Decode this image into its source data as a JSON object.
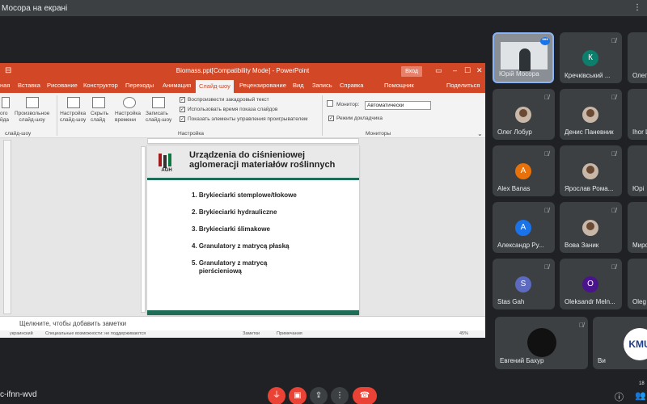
{
  "meet": {
    "top_title": "Мосора на екрані",
    "meeting_code": "c-ifnn-wvd",
    "participant_count": "18"
  },
  "powerpoint": {
    "window_title": "Biomass.ppt[Compatibility Mode]  -  PowerPoint",
    "login_label": "Вход",
    "tabs": [
      "ная",
      "Вставка",
      "Рисование",
      "Конструктор",
      "Переходы",
      "Анимация",
      "Слайд-шоу",
      "Рецензирование",
      "Вид",
      "Запись",
      "Справка",
      "Помощник",
      "Поделиться"
    ],
    "ribbon": {
      "btn_from_start": "ого\nйда",
      "btn_custom": "Произвольное\nслайд-шоу",
      "btn_setup": "Настройка\nслайд-шоу",
      "btn_hide": "Скрыть\nслайд",
      "btn_timing": "Настройка\nвремени",
      "btn_record": "Записать\nслайд-шоу",
      "chk_narration": "Воспроизвести закадровый текст",
      "chk_timings": "Использовать время показа слайдов",
      "chk_controls": "Показать элементы управления проигрывателем",
      "monitor_label": "Монитор:",
      "monitor_value": "Автоматически",
      "presenter_view": "Режим докладчика",
      "group_start": "слайд-шоу",
      "group_setup": "Настройка",
      "group_monitors": "Мониторы"
    },
    "slide": {
      "logo_text": "AGH",
      "title": "Urządzenia do ciśnieniowej aglomeracji materiałów roślinnych",
      "items": [
        "1. Brykieciarki stemplowe/tłokowe",
        "2. Brykieciarki hydrauliczne",
        "3. Brykieciarki ślimakowe",
        "4. Granulatory z matrycą płaską",
        "5. Granulatory z matrycą\n    pierścieniową"
      ]
    },
    "notes_placeholder": "Щелкните, чтобы добавить заметки",
    "status": {
      "lang": "украинский",
      "accessibility": "Специальные возможности: не поддерживаются",
      "notes": "Заметки",
      "comments": "Примечания",
      "zoom": "45%"
    }
  },
  "participants": [
    {
      "name": "Юрій Мосора",
      "type": "video"
    },
    {
      "name": "Кречківський ...",
      "type": "avatar",
      "initial": "К",
      "color": "#0d7e6b"
    },
    {
      "name": "Олег",
      "type": "cut"
    },
    {
      "name": "Олег Лобур",
      "type": "photo"
    },
    {
      "name": "Денис Паневник",
      "type": "photo"
    },
    {
      "name": "Ihor L",
      "type": "cut"
    },
    {
      "name": "Alex Banas",
      "type": "avatar",
      "initial": "A",
      "color": "#e8710a"
    },
    {
      "name": "Ярослав Рома...",
      "type": "photo"
    },
    {
      "name": "Юрі",
      "type": "cut"
    },
    {
      "name": "Александр Ру...",
      "type": "avatar",
      "initial": "A",
      "color": "#1a73e8"
    },
    {
      "name": "Вова Заник",
      "type": "photo"
    },
    {
      "name": "Миро",
      "type": "cut"
    },
    {
      "name": "Stas Gah",
      "type": "avatar",
      "initial": "S",
      "color": "#5c6bc0"
    },
    {
      "name": "Oleksandr Meln...",
      "type": "avatar",
      "initial": "O",
      "color": "#4a148c"
    },
    {
      "name": "Oleg",
      "type": "cut"
    }
  ],
  "bottom_tiles": [
    {
      "name": "Евгений Бахур"
    },
    {
      "name": "Ви",
      "logo": "KMU"
    }
  ]
}
